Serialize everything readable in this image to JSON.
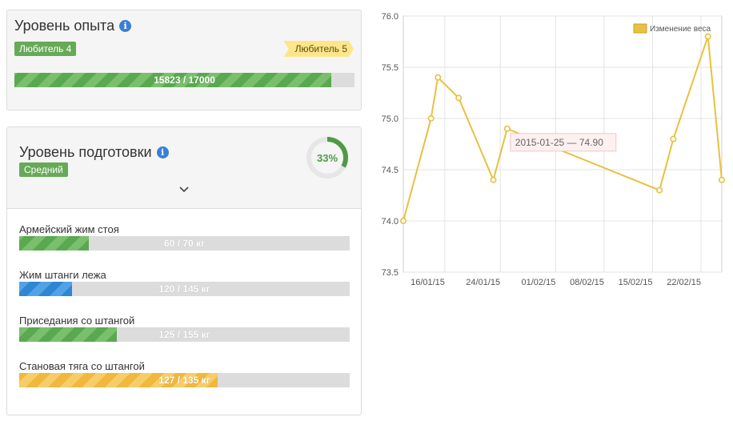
{
  "experience": {
    "title": "Уровень опыта",
    "current_level": "Любитель 4",
    "next_level": "Любитель 5",
    "progress_label": "15823 / 17000",
    "progress_fraction": 0.9308,
    "fill_color": "#5aa850"
  },
  "preparation": {
    "title": "Уровень подготовки",
    "level": "Средний",
    "percent_label": "33%",
    "percent_fraction": 0.33,
    "donut_color": "#4f9a46",
    "exercises": [
      {
        "name": "Армейский жим стоя",
        "label": "60 / 70 кг",
        "fraction": 0.21,
        "color": "green"
      },
      {
        "name": "Жим штанги лежа",
        "label": "120 / 145 кг",
        "fraction": 0.16,
        "color": "blue"
      },
      {
        "name": "Приседания со штангой",
        "label": "125 / 155 кг",
        "fraction": 0.295,
        "color": "green"
      },
      {
        "name": "Становая тяга со штангой",
        "label": "127 / 135 кг",
        "fraction": 0.6,
        "color": "yellow"
      }
    ]
  },
  "chart_data": {
    "type": "line",
    "series": [
      {
        "name": "Изменение веса",
        "color": "#e8c13f",
        "points": [
          {
            "x": "2015-01-10",
            "y": 74.0
          },
          {
            "x": "2015-01-14",
            "y": 75.0
          },
          {
            "x": "2015-01-15",
            "y": 75.4
          },
          {
            "x": "2015-01-18",
            "y": 75.2
          },
          {
            "x": "2015-01-23",
            "y": 74.4
          },
          {
            "x": "2015-01-25",
            "y": 74.9
          },
          {
            "x": "2015-02-16",
            "y": 74.3
          },
          {
            "x": "2015-02-18",
            "y": 74.8
          },
          {
            "x": "2015-02-23",
            "y": 75.8
          },
          {
            "x": "2015-02-25",
            "y": 74.4
          }
        ]
      }
    ],
    "ylim": [
      73.5,
      76.0
    ],
    "y_ticks": [
      "73.5",
      "74.0",
      "74.5",
      "75.0",
      "75.5",
      "76.0"
    ],
    "x_range": [
      "2015-01-10",
      "2015-02-25"
    ],
    "x_ticks": [
      {
        "date": "2015-01-16",
        "label": "16/01/15"
      },
      {
        "date": "2015-01-24",
        "label": "24/01/15"
      },
      {
        "date": "2015-02-01",
        "label": "01/02/15"
      },
      {
        "date": "2015-02-08",
        "label": "08/02/15"
      },
      {
        "date": "2015-02-15",
        "label": "15/02/15"
      },
      {
        "date": "2015-02-22",
        "label": "22/02/15"
      }
    ],
    "grid": true,
    "legend": "top-right",
    "tooltip": "2015-01-25 — 74.90"
  }
}
